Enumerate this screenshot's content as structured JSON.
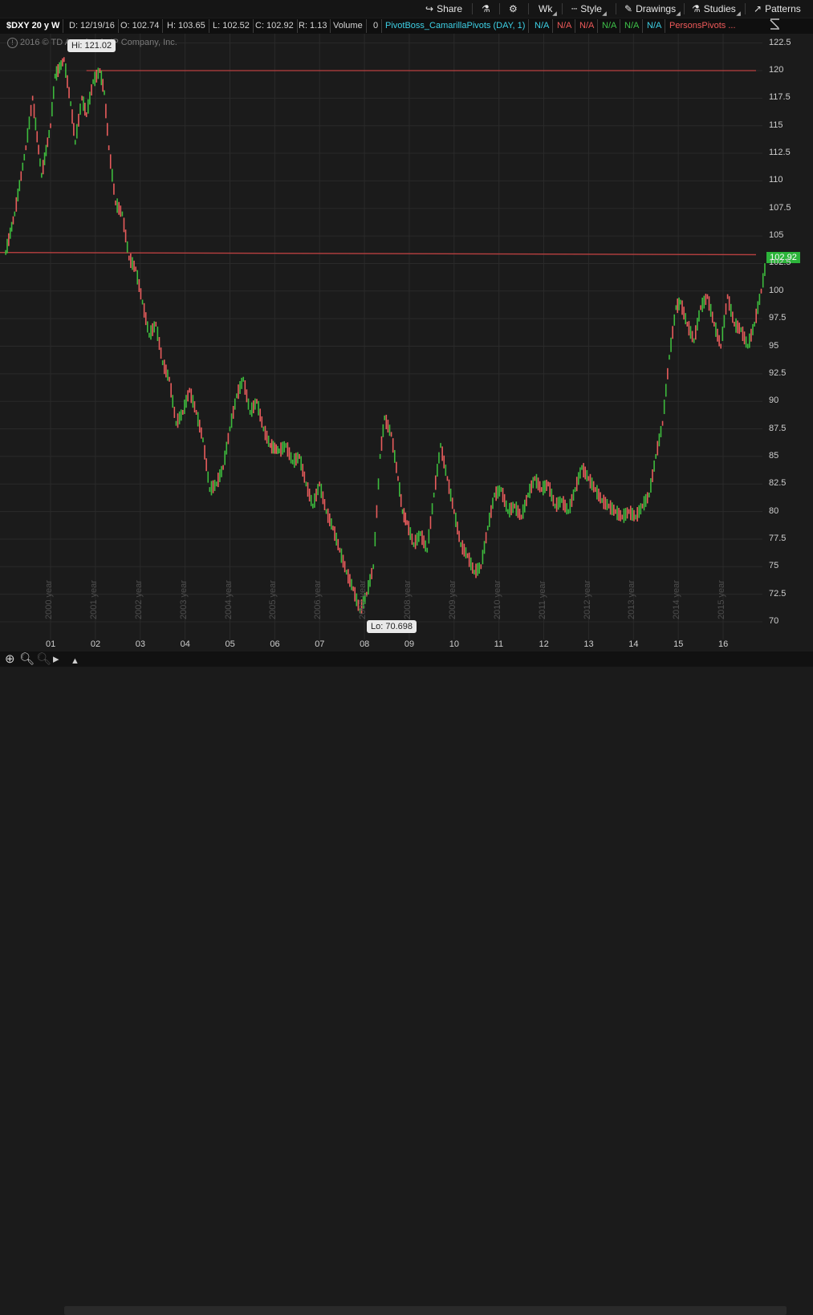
{
  "toolbar": {
    "share": "Share",
    "wk": "Wk",
    "style": "Style",
    "drawings": "Drawings",
    "studies": "Studies",
    "patterns": "Patterns"
  },
  "infobar": {
    "symbol": "$DXY 20 y W",
    "date": "D: 12/19/16",
    "open": "O: 102.74",
    "high": "H: 103.65",
    "low": "L: 102.52",
    "close": "C: 102.92",
    "range": "R: 1.13",
    "volume_label": "Volume",
    "volume_value": "0",
    "study1": "PivotBoss_CamarillaPivots (DAY, 1)",
    "na_values": [
      "N/A",
      "N/A",
      "N/A",
      "N/A",
      "N/A",
      "N/A"
    ],
    "study2": "PersonsPivots ..."
  },
  "copyright": "2016 © TD Ameritrade IP Company, Inc.",
  "hi_label": "Hi: 121.02",
  "lo_label": "Lo: 70.698",
  "last_price": "102.92",
  "chart_data": {
    "type": "line",
    "title": "",
    "xlabel": "",
    "ylabel": "",
    "ylim": [
      69,
      124
    ],
    "y_ticks": [
      "122.5",
      "120",
      "117.5",
      "115",
      "112.5",
      "110",
      "107.5",
      "105",
      "102.5",
      "100",
      "97.5",
      "95",
      "92.5",
      "90",
      "87.5",
      "85",
      "82.5",
      "80",
      "77.5",
      "75",
      "72.5",
      "70"
    ],
    "x_ticks": [
      "01",
      "02",
      "03",
      "04",
      "05",
      "06",
      "07",
      "08",
      "09",
      "10",
      "11",
      "12",
      "13",
      "14",
      "15",
      "16"
    ],
    "year_labels": [
      "2000 year",
      "2001 year",
      "2002 year",
      "2003 year",
      "2004 year",
      "2005 year",
      "2006 year",
      "2007 year",
      "2008 year",
      "2009 year",
      "2010 year",
      "2011 year",
      "2012 year",
      "2013 year",
      "2014 year",
      "2015 year"
    ],
    "x_range": [
      2000.0,
      2017.0
    ],
    "series": [
      {
        "x": [
          2000.0,
          2000.2,
          2000.45,
          2000.6,
          2000.8,
          2001.0,
          2001.1,
          2001.3,
          2001.45,
          2001.55,
          2001.7,
          2001.8,
          2001.95,
          2002.1,
          2002.2,
          2002.3,
          2002.45,
          2002.6,
          2002.75,
          2002.9,
          2003.05,
          2003.2,
          2003.35,
          2003.5,
          2003.65,
          2003.8,
          2003.95,
          2004.1,
          2004.25,
          2004.4,
          2004.55,
          2004.7,
          2004.85,
          2005.0,
          2005.15,
          2005.3,
          2005.45,
          2005.6,
          2005.75,
          2005.9,
          2006.1,
          2006.25,
          2006.4,
          2006.55,
          2006.7,
          2006.85,
          2007.0,
          2007.15,
          2007.3,
          2007.45,
          2007.6,
          2007.75,
          2007.9,
          2008.05,
          2008.2,
          2008.35,
          2008.45,
          2008.6,
          2008.75,
          2008.85,
          2008.95,
          2009.1,
          2009.25,
          2009.4,
          2009.55,
          2009.7,
          2009.85,
          2010.0,
          2010.15,
          2010.3,
          2010.45,
          2010.6,
          2010.75,
          2010.9,
          2011.05,
          2011.2,
          2011.35,
          2011.5,
          2011.65,
          2011.8,
          2011.95,
          2012.1,
          2012.25,
          2012.4,
          2012.55,
          2012.7,
          2012.85,
          2013.0,
          2013.15,
          2013.3,
          2013.45,
          2013.6,
          2013.75,
          2013.9,
          2014.05,
          2014.2,
          2014.35,
          2014.5,
          2014.65,
          2014.8,
          2014.95,
          2015.05,
          2015.2,
          2015.35,
          2015.5,
          2015.65,
          2015.8,
          2015.95,
          2016.1,
          2016.25,
          2016.4,
          2016.55,
          2016.7,
          2016.85,
          2016.97
        ],
        "values": [
          103.5,
          107.0,
          113.0,
          117.5,
          110.5,
          115.0,
          119.5,
          121.0,
          117.0,
          113.5,
          117.5,
          116.0,
          119.0,
          120.0,
          118.0,
          113.0,
          108.0,
          107.0,
          103.0,
          102.0,
          99.0,
          96.0,
          97.0,
          93.5,
          92.0,
          88.0,
          89.0,
          91.0,
          89.0,
          86.5,
          82.0,
          82.5,
          84.0,
          87.5,
          90.5,
          92.0,
          89.0,
          90.0,
          87.5,
          86.0,
          85.5,
          86.0,
          84.5,
          85.0,
          82.5,
          80.5,
          82.5,
          80.0,
          78.5,
          76.5,
          74.5,
          73.0,
          71.0,
          72.5,
          75.0,
          85.0,
          88.5,
          87.0,
          83.0,
          80.0,
          79.0,
          77.0,
          78.0,
          76.5,
          81.5,
          86.0,
          83.0,
          80.0,
          77.0,
          76.0,
          74.5,
          75.0,
          78.5,
          81.5,
          82.0,
          80.0,
          80.5,
          79.5,
          81.5,
          83.0,
          82.0,
          82.5,
          80.5,
          81.0,
          80.0,
          82.0,
          84.0,
          83.0,
          82.0,
          81.0,
          80.5,
          80.0,
          79.5,
          80.0,
          79.5,
          80.5,
          81.5,
          85.0,
          88.0,
          94.0,
          98.5,
          99.0,
          97.0,
          95.5,
          98.5,
          99.5,
          97.0,
          95.0,
          99.5,
          97.0,
          96.5,
          95.0,
          97.0,
          100.0,
          102.92
        ]
      }
    ],
    "horizontal_lines": [
      120.0,
      103.5
    ],
    "colors": {
      "up": "#3dbb3d",
      "down": "#e85c5c",
      "hline": "#b94040",
      "grid": "#2a2a2a"
    }
  },
  "icons": [
    "share-icon",
    "flask-icon",
    "gear-icon",
    "candle-style-icon",
    "pencil-icon",
    "studies-flask-icon",
    "patterns-icon",
    "zoom-icon",
    "zoom-in-icon",
    "zoom-out-icon",
    "pointer-icon",
    "scroll-arrow-icon"
  ]
}
